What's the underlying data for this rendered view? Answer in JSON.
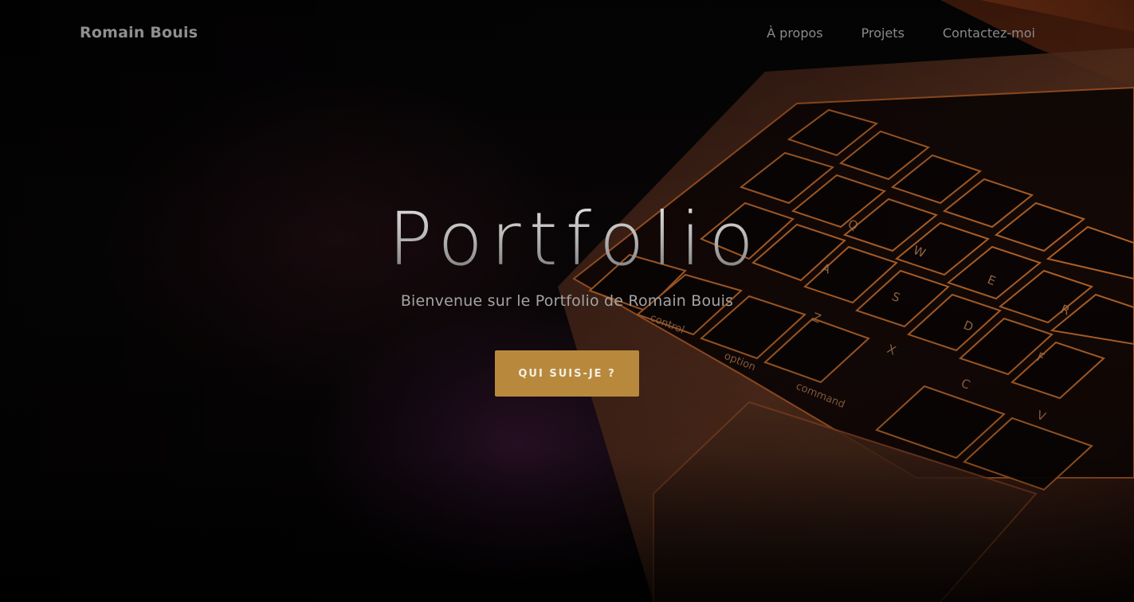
{
  "navbar": {
    "brand": "Romain Bouis",
    "links": [
      {
        "label": "À propos"
      },
      {
        "label": "Projets"
      },
      {
        "label": "Contactez-moi"
      }
    ]
  },
  "hero": {
    "title": "Portfolio",
    "subtitle": "Bienvenue sur le Portfolio de Romain Bouis",
    "cta_label": "QUI SUIS-JE ?",
    "background_image": "laptop-keyboard-photo",
    "keyboard_keys": [
      "control",
      "option",
      "command",
      "Q",
      "W",
      "E",
      "R",
      "A",
      "S",
      "D",
      "F",
      "Z",
      "X",
      "C",
      "V"
    ]
  },
  "colors": {
    "accent": "#b8893d",
    "nav_text": "#8a8a8a",
    "background": "#050505",
    "keyboard_glow": "#c2652a"
  }
}
